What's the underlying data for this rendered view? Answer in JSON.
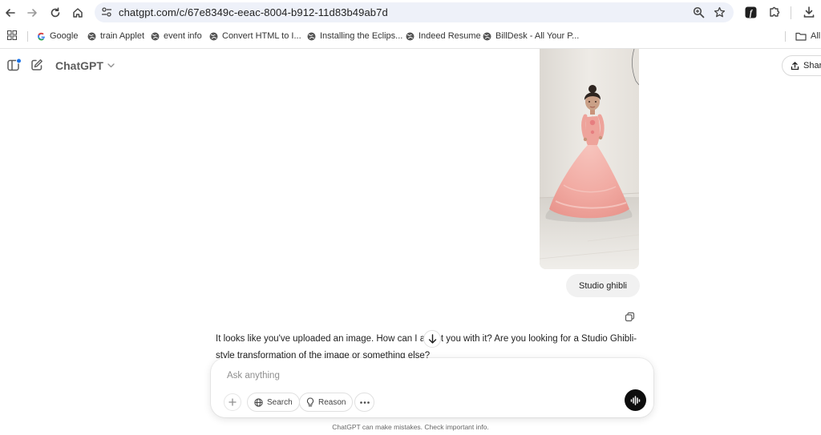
{
  "browser": {
    "url": "chatgpt.com/c/67e8349c-eeac-8004-b912-11d83b49ab7d",
    "bookmarks": [
      {
        "label": "Google",
        "icon": "google-g-icon"
      },
      {
        "label": "train Applet",
        "icon": "globe-icon"
      },
      {
        "label": "event info",
        "icon": "globe-icon"
      },
      {
        "label": "Convert HTML to I...",
        "icon": "globe-icon"
      },
      {
        "label": "Installing the Eclips...",
        "icon": "globe-icon"
      },
      {
        "label": "Indeed Resume",
        "icon": "globe-icon"
      },
      {
        "label": "BillDesk - All Your P...",
        "icon": "globe-icon"
      }
    ],
    "all_bookmarks_label": "All"
  },
  "app": {
    "title": "ChatGPT",
    "share_label": "Share"
  },
  "conversation": {
    "user_message": "Studio ghibli",
    "assistant_message": "It looks like you've uploaded an image. How can I assist you with it? Are you looking for a Studio Ghibli-style transformation of the image or something else?"
  },
  "composer": {
    "placeholder": "Ask anything",
    "search_label": "Search",
    "reason_label": "Reason"
  },
  "footer": {
    "disclaimer": "ChatGPT can make mistakes. Check important info."
  },
  "colors": {
    "accent": "#0d0d0d",
    "omnibox_bg": "#eef1f9",
    "bubble_bg": "#f1f1f1",
    "notification_dot": "#1a73e8"
  }
}
